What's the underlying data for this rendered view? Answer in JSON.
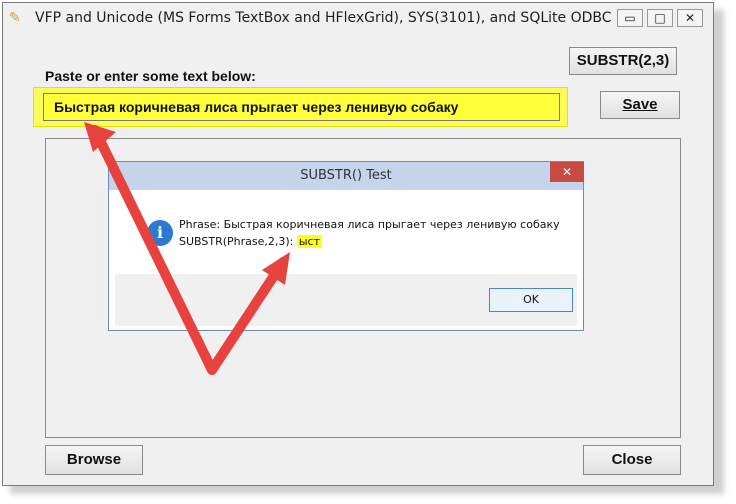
{
  "window": {
    "title": "VFP and Unicode (MS Forms TextBox and HFlexGrid), SYS(3101), and SQLite ODBC",
    "app_icon": "fox-icon",
    "minimize": "▭",
    "maximize": "□",
    "close": "✕"
  },
  "toolbar": {
    "substr_label": "SUBSTR(2,3)",
    "save_label": "Save"
  },
  "form": {
    "prompt": "Paste or enter some text below:",
    "text_value": "Быстрая коричневая лиса прыгает через ленивую собаку"
  },
  "footer": {
    "browse_label": "Browse",
    "close_label": "Close"
  },
  "dialog": {
    "title": "SUBSTR() Test",
    "close": "✕",
    "icon": "info-icon",
    "line1": "Phrase: Быстрая коричневая лиса прыгает через ленивую собаку",
    "line2_prefix": "SUBSTR(Phrase,2,3): ",
    "line2_value": "ыст",
    "ok_label": "OK"
  },
  "colors": {
    "highlight": "#ffff3a",
    "arrow": "#e8423e",
    "dialog_title_bg": "#c4d4ea",
    "dialog_close_bg": "#c74b43"
  }
}
